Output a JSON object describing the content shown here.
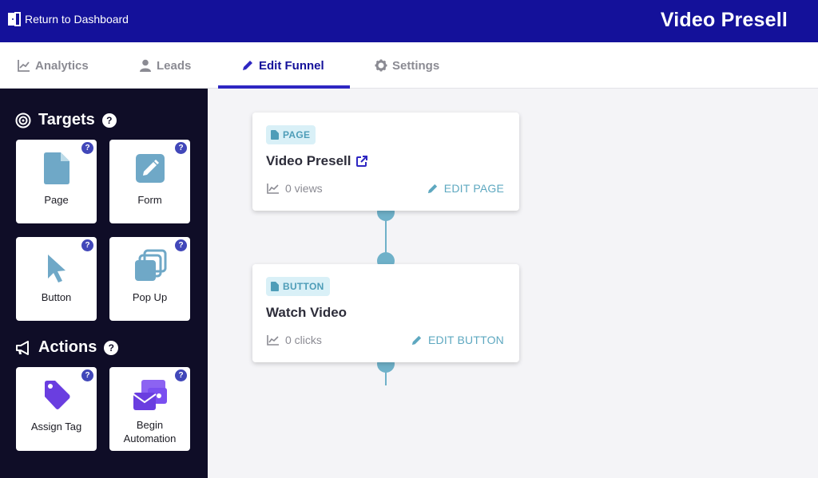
{
  "header": {
    "back_label": "Return to Dashboard",
    "title": "Video Presell"
  },
  "tabs": [
    {
      "label": "Analytics",
      "icon": "chart-line-icon",
      "active": false
    },
    {
      "label": "Leads",
      "icon": "user-icon",
      "active": false
    },
    {
      "label": "Edit Funnel",
      "icon": "pencil-icon",
      "active": true
    },
    {
      "label": "Settings",
      "icon": "gear-icon",
      "active": false
    }
  ],
  "sidebar": {
    "targets_heading": "Targets",
    "actions_heading": "Actions",
    "help_glyph": "?",
    "targets": [
      {
        "label": "Page",
        "icon": "page-icon"
      },
      {
        "label": "Form",
        "icon": "form-edit-icon"
      },
      {
        "label": "Button",
        "icon": "cursor-icon"
      },
      {
        "label": "Pop Up",
        "icon": "popup-icon"
      }
    ],
    "actions": [
      {
        "label": "Assign Tag",
        "icon": "tag-icon"
      },
      {
        "label": "Begin Automation",
        "line1": "Begin",
        "line2": "Automation",
        "icon": "automation-icon"
      }
    ]
  },
  "funnel": {
    "steps": [
      {
        "type": "PAGE",
        "title": "Video Presell",
        "stat": "0 views",
        "edit": "EDIT PAGE"
      },
      {
        "type": "BUTTON",
        "title": "Watch Video",
        "stat": "0 clicks",
        "edit": "EDIT BUTTON"
      }
    ]
  },
  "colors": {
    "header": "#14119a",
    "sidebar": "#0f0d27",
    "accent": "#2e27c2",
    "teal": "#6fb1c9",
    "tile_icon_blue": "#6fa8c7",
    "tile_icon_purple": "#6a3ee0",
    "badge": "#4147b9"
  }
}
